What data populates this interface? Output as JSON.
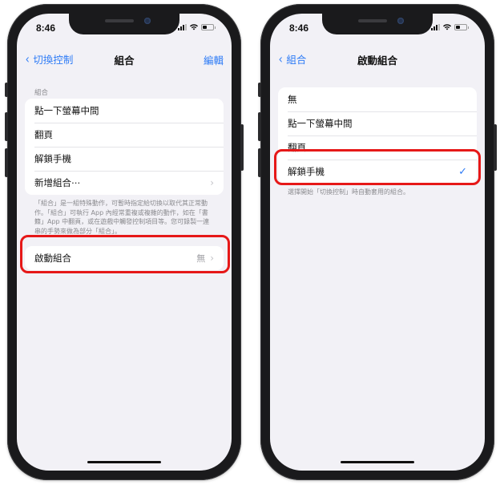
{
  "left_phone": {
    "status": {
      "time": "8:46",
      "battery_level": 0.45
    },
    "navbar": {
      "back_label": "切換控制",
      "title": "組合",
      "right_label": "編輯"
    },
    "recipes_section": {
      "header": "組合",
      "items": [
        {
          "label": "點一下螢幕中間"
        },
        {
          "label": "翻頁"
        },
        {
          "label": "解鎖手機"
        },
        {
          "label": "新增組合⋯",
          "has_chevron": true
        }
      ],
      "footer": "「組合」是一組特殊動作，可暫時指定給切換以取代其正常動作。「組合」可執行 App 內經常重複或複雜的動作，如在「書籍」App 中翻頁，或在遊戲中觸發控制項目等。您可錄製一連串的手勢來做為部分「組合」。"
    },
    "launch_recipe": {
      "label": "啟動組合",
      "value": "無"
    }
  },
  "right_phone": {
    "status": {
      "time": "8:46",
      "battery_level": 0.45
    },
    "navbar": {
      "back_label": "組合",
      "title": "啟動組合"
    },
    "options": [
      {
        "label": "無",
        "selected": false
      },
      {
        "label": "點一下螢幕中間",
        "selected": false
      },
      {
        "label": "翻頁",
        "selected": false
      },
      {
        "label": "解鎖手機",
        "selected": true
      }
    ],
    "footer": "選擇開始「切換控制」時自動套用的組合。"
  },
  "icons": {
    "back_chevron": "‹",
    "chevron_right": "›",
    "checkmark": "✓"
  },
  "colors": {
    "accent": "#2f7cf6",
    "highlight": "#e61818",
    "background": "#f2f1f6"
  }
}
